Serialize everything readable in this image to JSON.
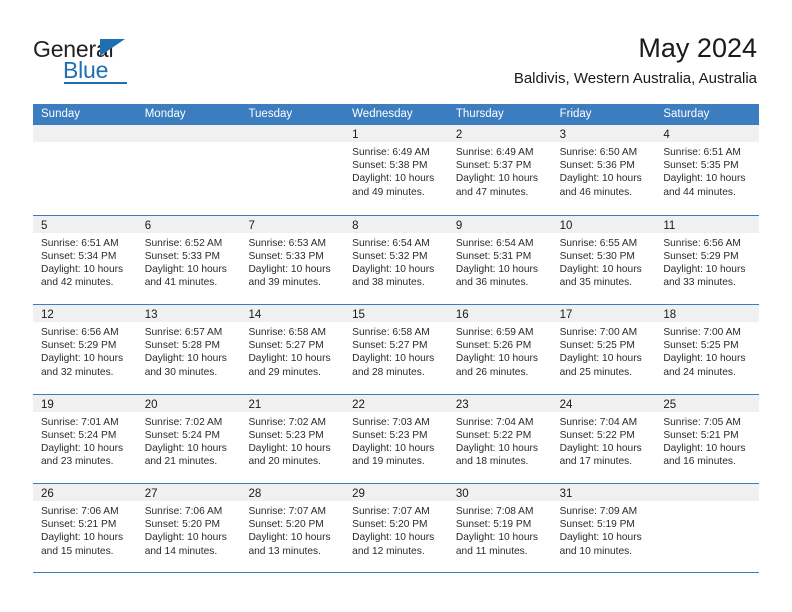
{
  "brand": {
    "line1": "General",
    "line2": "Blue",
    "accent_color": "#1f6fb2"
  },
  "header": {
    "title": "May 2024",
    "subtitle": "Baldivis, Western Australia, Australia"
  },
  "calendar": {
    "header_bg": "#3b7dbf",
    "daynum_bg": "#f0f0f0",
    "weekdays": [
      "Sunday",
      "Monday",
      "Tuesday",
      "Wednesday",
      "Thursday",
      "Friday",
      "Saturday"
    ],
    "labels": {
      "sunrise": "Sunrise:",
      "sunset": "Sunset:",
      "daylight": "Daylight:"
    },
    "weeks": [
      [
        {
          "day": "",
          "empty": true
        },
        {
          "day": "",
          "empty": true
        },
        {
          "day": "",
          "empty": true
        },
        {
          "day": "1",
          "sunrise": "Sunrise: 6:49 AM",
          "sunset": "Sunset: 5:38 PM",
          "daylight1": "Daylight: 10 hours",
          "daylight2": "and 49 minutes."
        },
        {
          "day": "2",
          "sunrise": "Sunrise: 6:49 AM",
          "sunset": "Sunset: 5:37 PM",
          "daylight1": "Daylight: 10 hours",
          "daylight2": "and 47 minutes."
        },
        {
          "day": "3",
          "sunrise": "Sunrise: 6:50 AM",
          "sunset": "Sunset: 5:36 PM",
          "daylight1": "Daylight: 10 hours",
          "daylight2": "and 46 minutes."
        },
        {
          "day": "4",
          "sunrise": "Sunrise: 6:51 AM",
          "sunset": "Sunset: 5:35 PM",
          "daylight1": "Daylight: 10 hours",
          "daylight2": "and 44 minutes."
        }
      ],
      [
        {
          "day": "5",
          "sunrise": "Sunrise: 6:51 AM",
          "sunset": "Sunset: 5:34 PM",
          "daylight1": "Daylight: 10 hours",
          "daylight2": "and 42 minutes."
        },
        {
          "day": "6",
          "sunrise": "Sunrise: 6:52 AM",
          "sunset": "Sunset: 5:33 PM",
          "daylight1": "Daylight: 10 hours",
          "daylight2": "and 41 minutes."
        },
        {
          "day": "7",
          "sunrise": "Sunrise: 6:53 AM",
          "sunset": "Sunset: 5:33 PM",
          "daylight1": "Daylight: 10 hours",
          "daylight2": "and 39 minutes."
        },
        {
          "day": "8",
          "sunrise": "Sunrise: 6:54 AM",
          "sunset": "Sunset: 5:32 PM",
          "daylight1": "Daylight: 10 hours",
          "daylight2": "and 38 minutes."
        },
        {
          "day": "9",
          "sunrise": "Sunrise: 6:54 AM",
          "sunset": "Sunset: 5:31 PM",
          "daylight1": "Daylight: 10 hours",
          "daylight2": "and 36 minutes."
        },
        {
          "day": "10",
          "sunrise": "Sunrise: 6:55 AM",
          "sunset": "Sunset: 5:30 PM",
          "daylight1": "Daylight: 10 hours",
          "daylight2": "and 35 minutes."
        },
        {
          "day": "11",
          "sunrise": "Sunrise: 6:56 AM",
          "sunset": "Sunset: 5:29 PM",
          "daylight1": "Daylight: 10 hours",
          "daylight2": "and 33 minutes."
        }
      ],
      [
        {
          "day": "12",
          "sunrise": "Sunrise: 6:56 AM",
          "sunset": "Sunset: 5:29 PM",
          "daylight1": "Daylight: 10 hours",
          "daylight2": "and 32 minutes."
        },
        {
          "day": "13",
          "sunrise": "Sunrise: 6:57 AM",
          "sunset": "Sunset: 5:28 PM",
          "daylight1": "Daylight: 10 hours",
          "daylight2": "and 30 minutes."
        },
        {
          "day": "14",
          "sunrise": "Sunrise: 6:58 AM",
          "sunset": "Sunset: 5:27 PM",
          "daylight1": "Daylight: 10 hours",
          "daylight2": "and 29 minutes."
        },
        {
          "day": "15",
          "sunrise": "Sunrise: 6:58 AM",
          "sunset": "Sunset: 5:27 PM",
          "daylight1": "Daylight: 10 hours",
          "daylight2": "and 28 minutes."
        },
        {
          "day": "16",
          "sunrise": "Sunrise: 6:59 AM",
          "sunset": "Sunset: 5:26 PM",
          "daylight1": "Daylight: 10 hours",
          "daylight2": "and 26 minutes."
        },
        {
          "day": "17",
          "sunrise": "Sunrise: 7:00 AM",
          "sunset": "Sunset: 5:25 PM",
          "daylight1": "Daylight: 10 hours",
          "daylight2": "and 25 minutes."
        },
        {
          "day": "18",
          "sunrise": "Sunrise: 7:00 AM",
          "sunset": "Sunset: 5:25 PM",
          "daylight1": "Daylight: 10 hours",
          "daylight2": "and 24 minutes."
        }
      ],
      [
        {
          "day": "19",
          "sunrise": "Sunrise: 7:01 AM",
          "sunset": "Sunset: 5:24 PM",
          "daylight1": "Daylight: 10 hours",
          "daylight2": "and 23 minutes."
        },
        {
          "day": "20",
          "sunrise": "Sunrise: 7:02 AM",
          "sunset": "Sunset: 5:24 PM",
          "daylight1": "Daylight: 10 hours",
          "daylight2": "and 21 minutes."
        },
        {
          "day": "21",
          "sunrise": "Sunrise: 7:02 AM",
          "sunset": "Sunset: 5:23 PM",
          "daylight1": "Daylight: 10 hours",
          "daylight2": "and 20 minutes."
        },
        {
          "day": "22",
          "sunrise": "Sunrise: 7:03 AM",
          "sunset": "Sunset: 5:23 PM",
          "daylight1": "Daylight: 10 hours",
          "daylight2": "and 19 minutes."
        },
        {
          "day": "23",
          "sunrise": "Sunrise: 7:04 AM",
          "sunset": "Sunset: 5:22 PM",
          "daylight1": "Daylight: 10 hours",
          "daylight2": "and 18 minutes."
        },
        {
          "day": "24",
          "sunrise": "Sunrise: 7:04 AM",
          "sunset": "Sunset: 5:22 PM",
          "daylight1": "Daylight: 10 hours",
          "daylight2": "and 17 minutes."
        },
        {
          "day": "25",
          "sunrise": "Sunrise: 7:05 AM",
          "sunset": "Sunset: 5:21 PM",
          "daylight1": "Daylight: 10 hours",
          "daylight2": "and 16 minutes."
        }
      ],
      [
        {
          "day": "26",
          "sunrise": "Sunrise: 7:06 AM",
          "sunset": "Sunset: 5:21 PM",
          "daylight1": "Daylight: 10 hours",
          "daylight2": "and 15 minutes."
        },
        {
          "day": "27",
          "sunrise": "Sunrise: 7:06 AM",
          "sunset": "Sunset: 5:20 PM",
          "daylight1": "Daylight: 10 hours",
          "daylight2": "and 14 minutes."
        },
        {
          "day": "28",
          "sunrise": "Sunrise: 7:07 AM",
          "sunset": "Sunset: 5:20 PM",
          "daylight1": "Daylight: 10 hours",
          "daylight2": "and 13 minutes."
        },
        {
          "day": "29",
          "sunrise": "Sunrise: 7:07 AM",
          "sunset": "Sunset: 5:20 PM",
          "daylight1": "Daylight: 10 hours",
          "daylight2": "and 12 minutes."
        },
        {
          "day": "30",
          "sunrise": "Sunrise: 7:08 AM",
          "sunset": "Sunset: 5:19 PM",
          "daylight1": "Daylight: 10 hours",
          "daylight2": "and 11 minutes."
        },
        {
          "day": "31",
          "sunrise": "Sunrise: 7:09 AM",
          "sunset": "Sunset: 5:19 PM",
          "daylight1": "Daylight: 10 hours",
          "daylight2": "and 10 minutes."
        },
        {
          "day": "",
          "empty": true
        }
      ]
    ]
  }
}
